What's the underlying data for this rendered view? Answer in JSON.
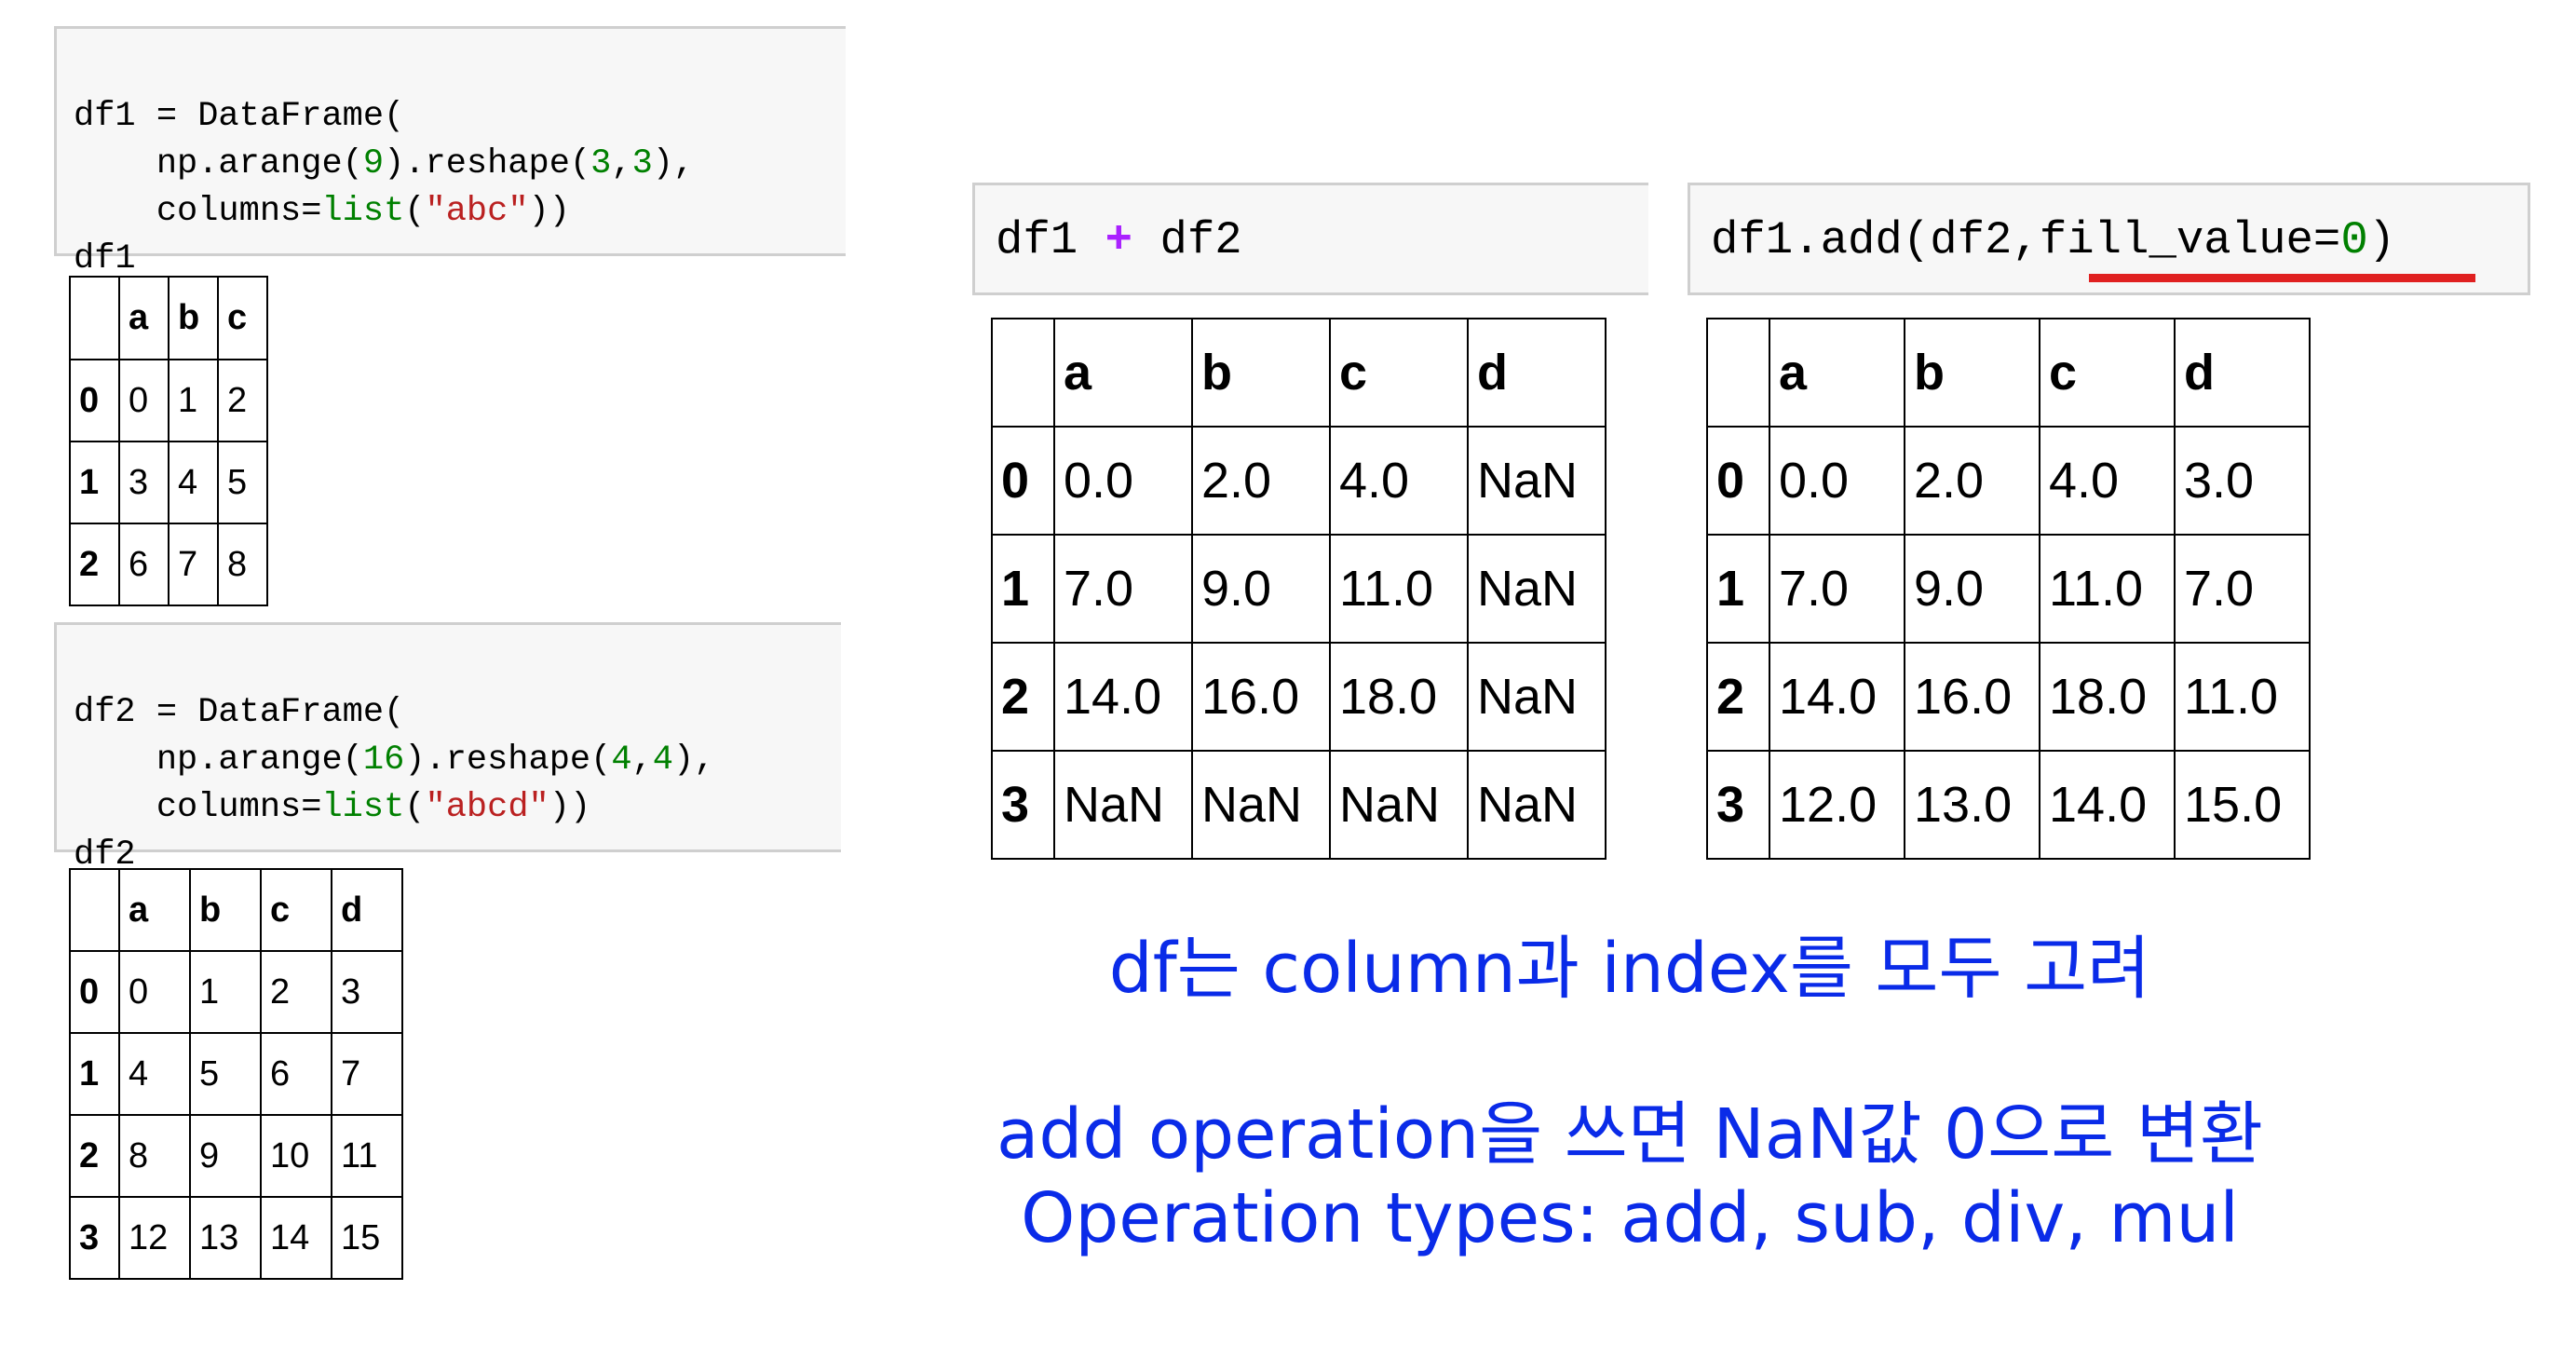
{
  "cells": {
    "df1_code": [
      "df1 = DataFrame(",
      "    np.arange(9).reshape(3,3),",
      "    columns=list(\"abc\"))",
      "df1"
    ],
    "df2_code": [
      "df2 = DataFrame(",
      "    np.arange(16).reshape(4,4),",
      "    columns=list(\"abcd\"))",
      "df2"
    ],
    "plus_code": {
      "left": "df1",
      "op": "+",
      "right": "df2"
    },
    "add_code": {
      "prefix": "df1.add(df2,",
      "kw": "fill_value=",
      "val": "0",
      "suffix": ")"
    }
  },
  "tables": {
    "df1": {
      "columns": [
        "a",
        "b",
        "c"
      ],
      "index": [
        "0",
        "1",
        "2"
      ],
      "rows": [
        [
          "0",
          "1",
          "2"
        ],
        [
          "3",
          "4",
          "5"
        ],
        [
          "6",
          "7",
          "8"
        ]
      ]
    },
    "df2": {
      "columns": [
        "a",
        "b",
        "c",
        "d"
      ],
      "index": [
        "0",
        "1",
        "2",
        "3"
      ],
      "rows": [
        [
          "0",
          "1",
          "2",
          "3"
        ],
        [
          "4",
          "5",
          "6",
          "7"
        ],
        [
          "8",
          "9",
          "10",
          "11"
        ],
        [
          "12",
          "13",
          "14",
          "15"
        ]
      ]
    },
    "sum": {
      "columns": [
        "a",
        "b",
        "c",
        "d"
      ],
      "index": [
        "0",
        "1",
        "2",
        "3"
      ],
      "rows": [
        [
          "0.0",
          "2.0",
          "4.0",
          "NaN"
        ],
        [
          "7.0",
          "9.0",
          "11.0",
          "NaN"
        ],
        [
          "14.0",
          "16.0",
          "18.0",
          "NaN"
        ],
        [
          "NaN",
          "NaN",
          "NaN",
          "NaN"
        ]
      ]
    },
    "add": {
      "columns": [
        "a",
        "b",
        "c",
        "d"
      ],
      "index": [
        "0",
        "1",
        "2",
        "3"
      ],
      "rows": [
        [
          "0.0",
          "2.0",
          "4.0",
          "3.0"
        ],
        [
          "7.0",
          "9.0",
          "11.0",
          "7.0"
        ],
        [
          "14.0",
          "16.0",
          "18.0",
          "11.0"
        ],
        [
          "12.0",
          "13.0",
          "14.0",
          "15.0"
        ]
      ]
    }
  },
  "notes": {
    "line1": "df는 column과 index를 모두 고려",
    "line2": "add operation을 쓰면 NaN값 0으로 변환",
    "line3": "Operation types: add, sub, div, mul"
  },
  "colors": {
    "note": "#0a2be8",
    "underline": "#e02020",
    "code_number": "#008000",
    "code_string": "#ba2121",
    "operator": "#aa22ff"
  }
}
